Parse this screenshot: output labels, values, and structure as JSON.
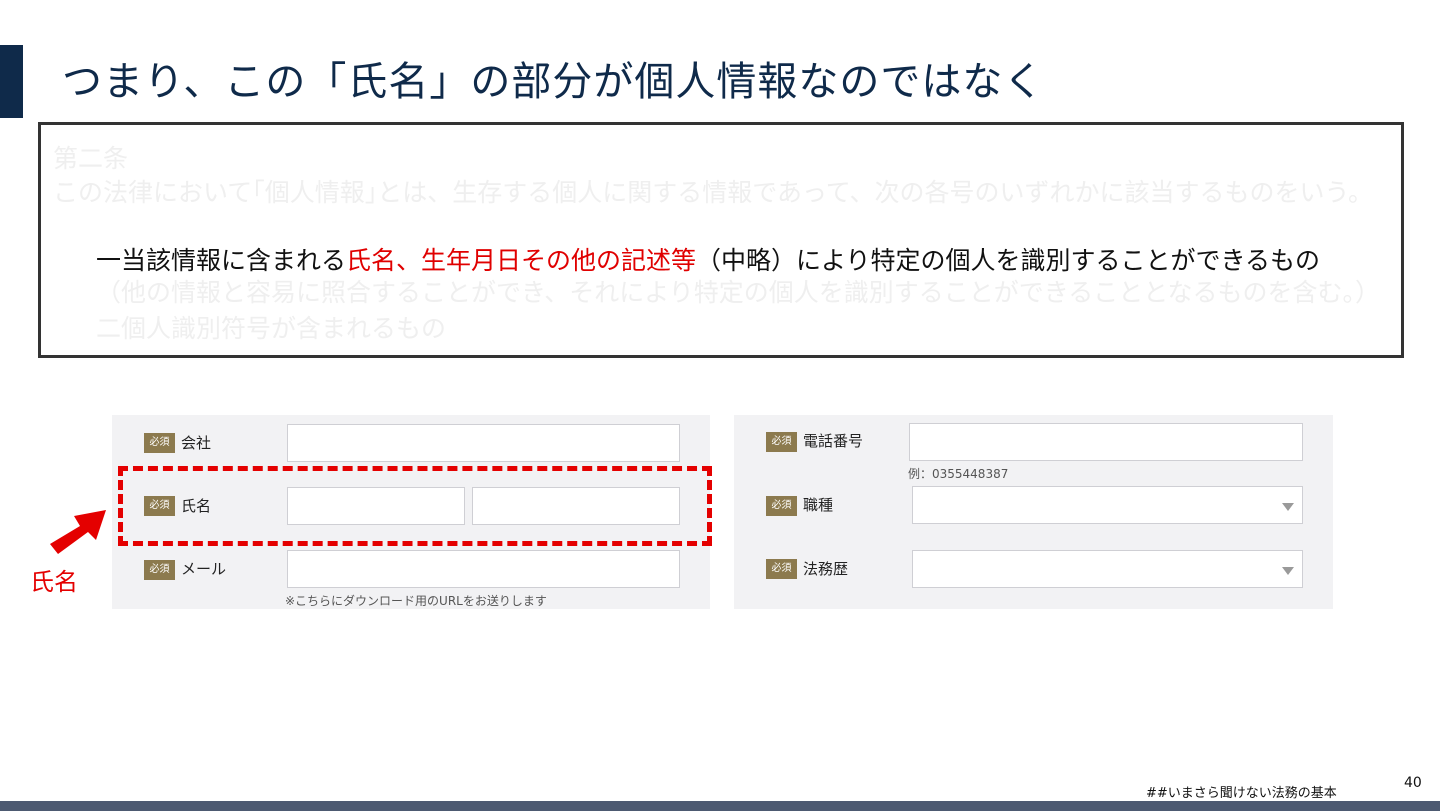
{
  "slide": {
    "title": "つまり、この「氏名」の部分が個人情報なのではなく",
    "page_number": "40",
    "footer_tag": "##いまさら聞けない法務の基本"
  },
  "law_text": {
    "heading": "第二条",
    "definition": "この法律において｢個人情報｣とは、生存する個人に関する情報であって、次の各号のいずれかに該当するものをいう。",
    "item1_prefix": "一当該情報に含まれる",
    "item1_highlight": "氏名、生年月日その他の記述等",
    "item1_suffix": "（中略）により特定の個人を識別することができるもの",
    "item1_cont": "（他の情報と容易に照合することができ、それにより特定の個人を識別することができることとなるものを含む。）",
    "item2": "二個人識別符号が含まれるもの"
  },
  "form": {
    "required_badge": "必須",
    "left": {
      "company_label": "会社",
      "name_label": "氏名",
      "mail_label": "メール",
      "mail_hint": "※こちらにダウンロード用のURLをお送りします"
    },
    "right": {
      "phone_label": "電話番号",
      "phone_example": "例：0355448387",
      "job_label": "職種",
      "legal_label": "法務歴"
    }
  },
  "annotation": {
    "callout": "氏名",
    "colors": {
      "highlight": "#e40000",
      "title": "#0f2a4a",
      "badge": "#8c7a4e"
    }
  }
}
